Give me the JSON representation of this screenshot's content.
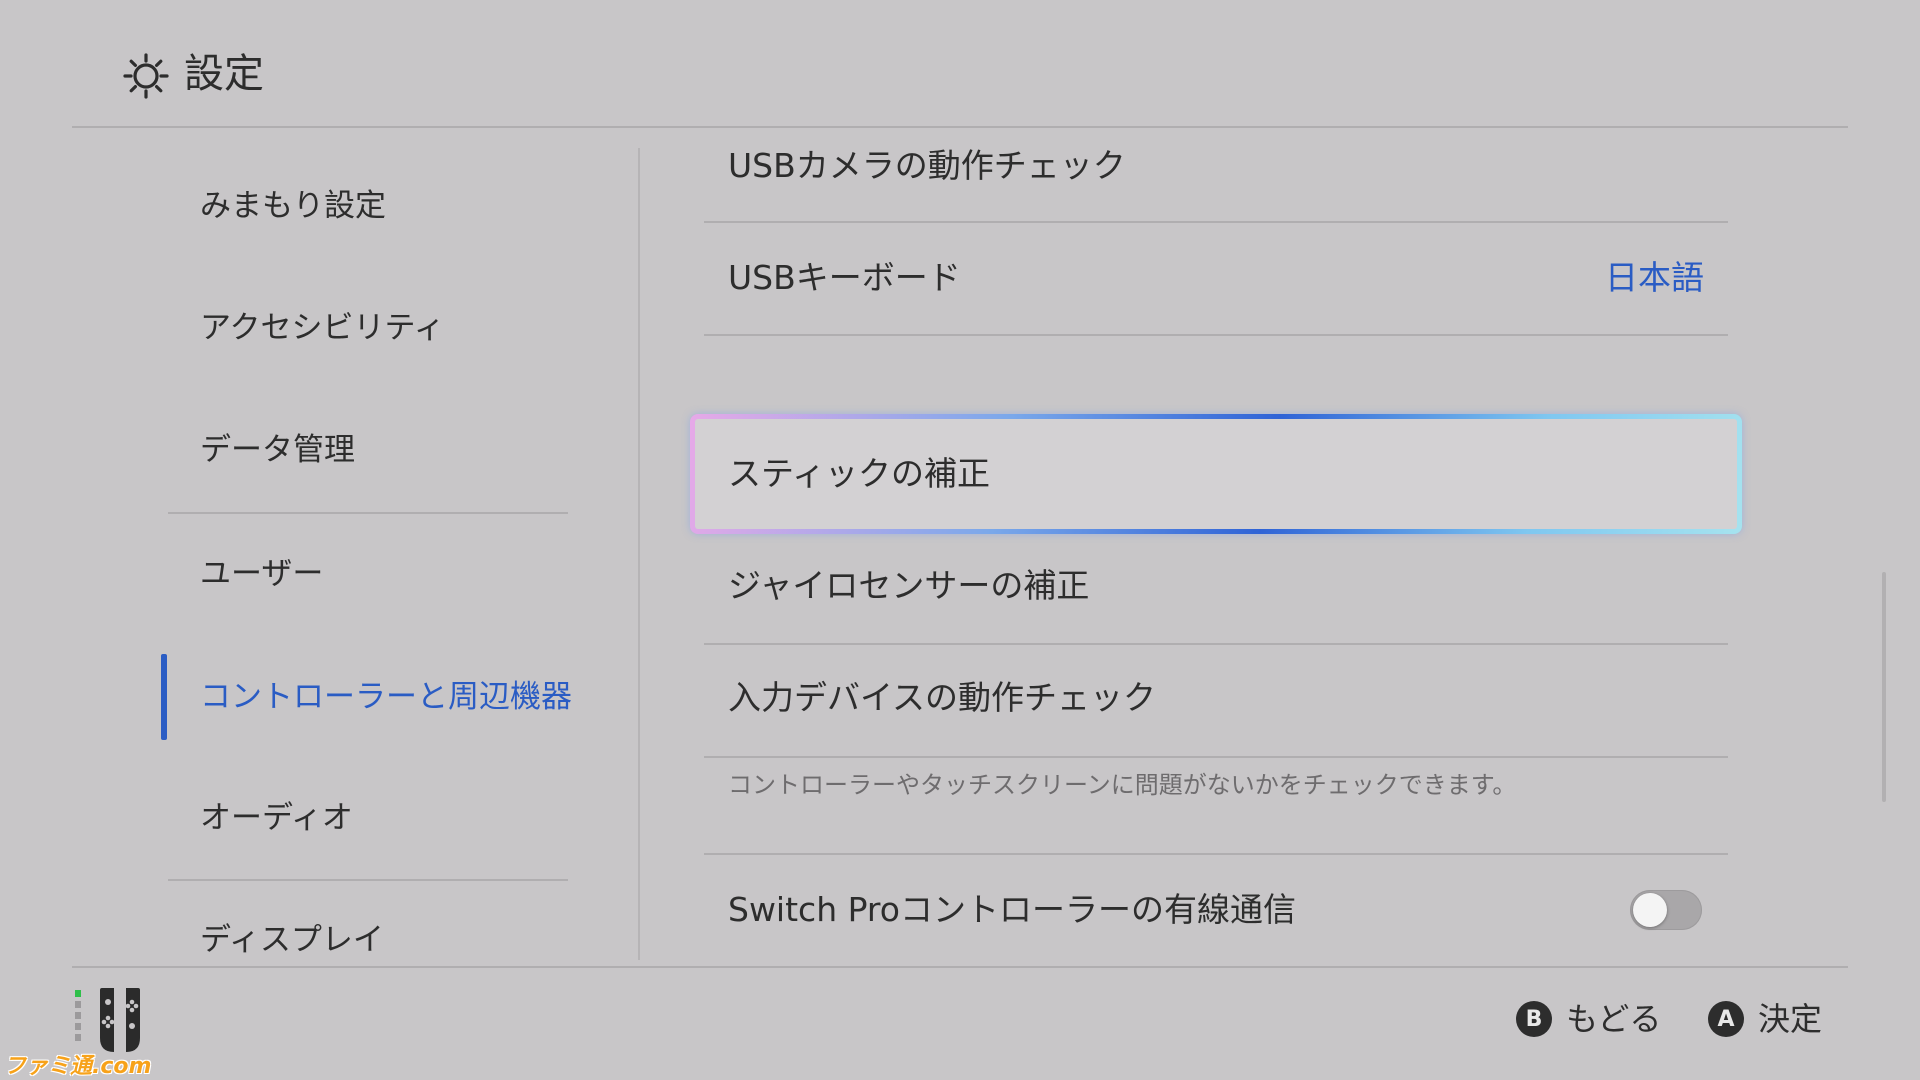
{
  "header": {
    "title": "設定",
    "icon": "gear-icon"
  },
  "sidebar": {
    "items": [
      {
        "label": "みまもり設定",
        "active": false
      },
      {
        "label": "アクセシビリティ",
        "active": false
      },
      {
        "label": "データ管理",
        "active": false
      },
      {
        "label": "ユーザー",
        "active": false
      },
      {
        "label": "コントローラーと周辺機器",
        "active": true
      },
      {
        "label": "オーディオ",
        "active": false
      },
      {
        "label": "ディスプレイ",
        "active": false
      }
    ]
  },
  "content": {
    "rows": [
      {
        "label": "USBカメラの動作チェック"
      },
      {
        "label": "USBキーボード",
        "value": "日本語"
      },
      {
        "label": "スティックの補正",
        "selected": true
      },
      {
        "label": "ジャイロセンサーの補正"
      },
      {
        "label": "入力デバイスの動作チェック",
        "description": "コントローラーやタッチスクリーンに問題がないかをチェックできます。"
      },
      {
        "label": "Switch Proコントローラーの有線通信",
        "toggle": false
      }
    ]
  },
  "footer": {
    "back": {
      "key": "B",
      "label": "もどる"
    },
    "confirm": {
      "key": "A",
      "label": "決定"
    },
    "controller_icon": "joycon-icon"
  },
  "watermark": "ファミ通.com",
  "colors": {
    "background": "#c8c6c8",
    "accent": "#2a5cc4",
    "text": "#2d2d2d"
  }
}
